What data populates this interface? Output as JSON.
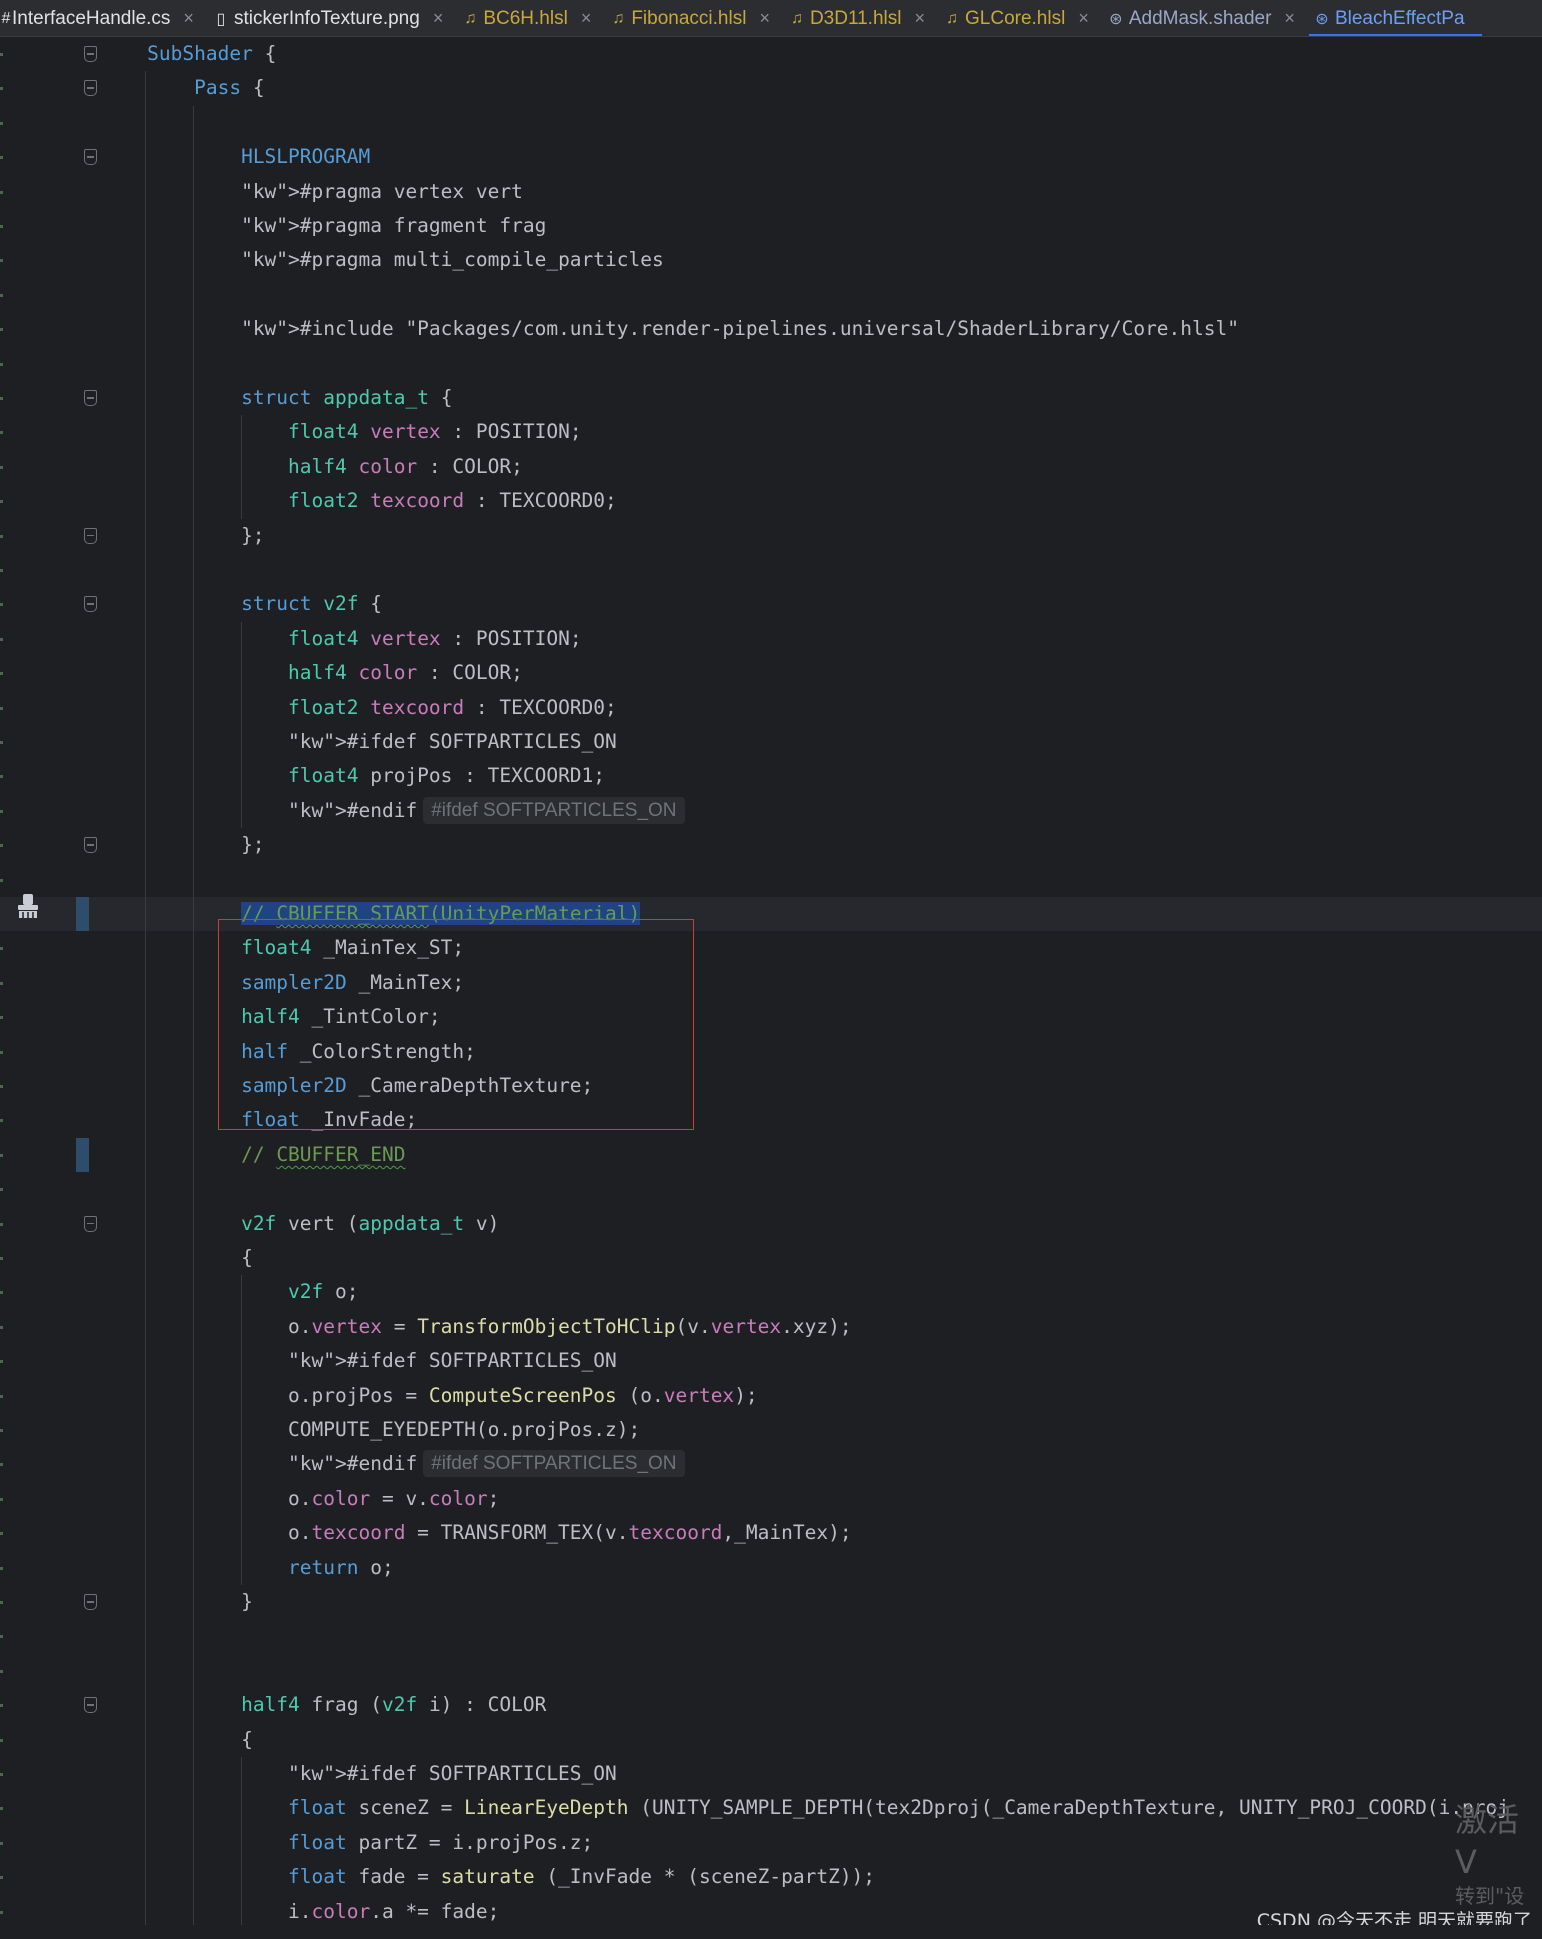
{
  "tabs": [
    {
      "label": "InterfaceHandle.cs",
      "icon": "csharp-file-icon",
      "color": "#dfe1e5"
    },
    {
      "label": "stickerInfoTexture.png",
      "icon": "image-file-icon",
      "color": "#dfe1e5"
    },
    {
      "label": "BC6H.hlsl",
      "icon": "shader-file-icon",
      "color": "#c8a83c"
    },
    {
      "label": "Fibonacci.hlsl",
      "icon": "shader-file-icon",
      "color": "#c8a83c"
    },
    {
      "label": "D3D11.hlsl",
      "icon": "shader-file-icon",
      "color": "#c8a83c"
    },
    {
      "label": "GLCore.hlsl",
      "icon": "shader-file-icon",
      "color": "#c8a83c"
    },
    {
      "label": "AddMask.shader",
      "icon": "unity-shader-icon",
      "color": "#9aa8c8"
    },
    {
      "label": "BleachEffectPa",
      "icon": "unity-shader-icon",
      "color": "#6c9ff5",
      "active": true
    }
  ],
  "code_lines": [
    "    SubShader {",
    "        Pass {",
    "",
    "            HLSLPROGRAM",
    "            #pragma vertex vert",
    "            #pragma fragment frag",
    "            #pragma multi_compile_particles",
    "",
    "            #include \"Packages/com.unity.render-pipelines.universal/ShaderLibrary/Core.hlsl\"",
    "",
    "            struct appdata_t {",
    "                float4 vertex : POSITION;",
    "                half4 color : COLOR;",
    "                float2 texcoord : TEXCOORD0;",
    "            };",
    "",
    "            struct v2f {",
    "                float4 vertex : POSITION;",
    "                half4 color : COLOR;",
    "                float2 texcoord : TEXCOORD0;",
    "                #ifdef SOFTPARTICLES_ON",
    "                float4 projPos : TEXCOORD1;",
    "                #endif",
    "            };",
    "",
    "            // CBUFFER_START(UnityPerMaterial)",
    "            float4 _MainTex_ST;",
    "            sampler2D _MainTex;",
    "            half4 _TintColor;",
    "            half _ColorStrength;",
    "            sampler2D _CameraDepthTexture;",
    "            float _InvFade;",
    "            // CBUFFER_END",
    "",
    "            v2f vert (appdata_t v)",
    "            {",
    "                v2f o;",
    "                o.vertex = TransformObjectToHClip(v.vertex.xyz);",
    "                #ifdef SOFTPARTICLES_ON",
    "                o.projPos = ComputeScreenPos (o.vertex);",
    "                COMPUTE_EYEDEPTH(o.projPos.z);",
    "                #endif",
    "                o.color = v.color;",
    "                o.texcoord = TRANSFORM_TEX(v.texcoord,_MainTex);",
    "                return o;",
    "            }",
    "",
    "",
    "            half4 frag (v2f i) : COLOR",
    "            {",
    "                #ifdef SOFTPARTICLES_ON",
    "                float sceneZ = LinearEyeDepth (UNITY_SAMPLE_DEPTH(tex2Dproj(_CameraDepthTexture, UNITY_PROJ_COORD(i.proj",
    "                float partZ = i.projPos.z;",
    "                float fade = saturate (_InvFade * (sceneZ-partZ));",
    "                i.color.a *= fade;"
  ],
  "inlay_hints": {
    "endif_hint_1": "#ifdef SOFTPARTICLES_ON",
    "endif_hint_2": "#ifdef SOFTPARTICLES_ON"
  },
  "watermark": {
    "activate_line1": "激活 V",
    "activate_line2": "转到\"设",
    "csdn": "CSDN @今天不走 明天就要跑了"
  },
  "colors": {
    "background": "#1e1f22",
    "keyword": "#569cd6",
    "type": "#4ec9b0",
    "field": "#c77dbb",
    "string": "#ce9178",
    "comment": "#6a9955",
    "highlight_box": "#d03a3a",
    "active_tab": "#6c9ff5"
  }
}
